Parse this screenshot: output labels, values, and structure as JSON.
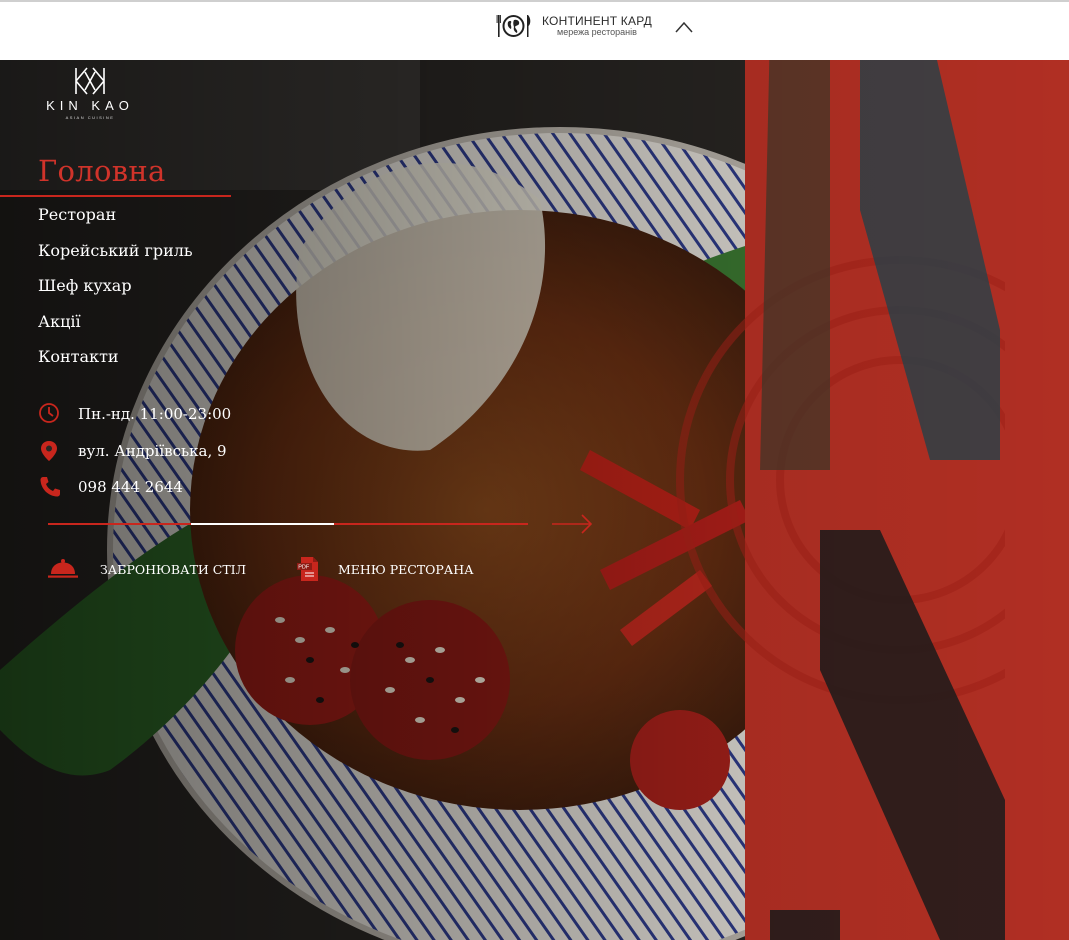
{
  "topbar": {
    "brand_name": "КОНТИНЕНТ КАРД",
    "brand_sub": "мережа ресторанів",
    "icon": "globe-fork-knife-icon",
    "toggle_icon": "chevron-up-icon"
  },
  "logo": {
    "word": "KIN KAO",
    "tagline": "ASIAN CUISINE"
  },
  "nav": {
    "active": "Головна",
    "items": [
      {
        "label": "Ресторан"
      },
      {
        "label": "Корейський гриль"
      },
      {
        "label": "Шеф кухар"
      },
      {
        "label": "Акції"
      },
      {
        "label": "Контакти"
      }
    ]
  },
  "info": {
    "hours": "Пн.-нд. 11:00-23:00",
    "address": "вул. Андріївська, 9",
    "phone": "098 444 2644"
  },
  "actions": {
    "book": "ЗАБРОНЮВАТИ СТІЛ",
    "menu": "МЕНЮ РЕСТОРАНА"
  },
  "colors": {
    "accent": "#c8261d",
    "accent_text": "#d0332a",
    "topbar_bg": "#ffffff"
  },
  "slider": {
    "slide_count": 3,
    "active_slide": 2
  }
}
